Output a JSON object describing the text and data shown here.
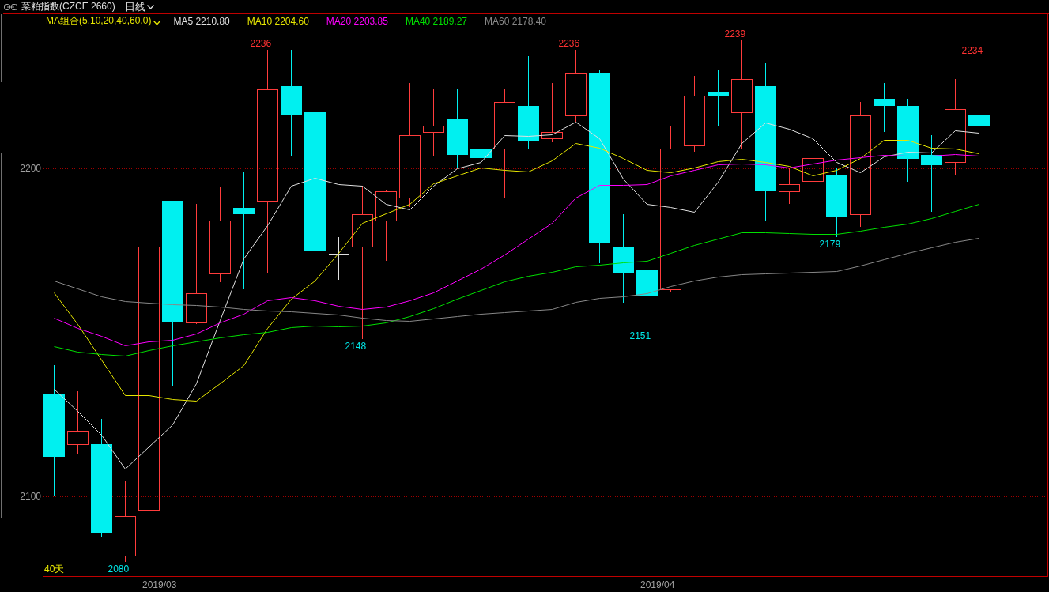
{
  "header": {
    "symbol": "菜粕指数(CZCE 2660)",
    "period": "日线"
  },
  "legend": {
    "indicator": "MA组合(5,10,20,40,60,0)",
    "items": [
      {
        "label": "MA5 2210.80",
        "color": "#e0e0e0"
      },
      {
        "label": "MA10 2204.60",
        "color": "#e6e600"
      },
      {
        "label": "MA20 2203.85",
        "color": "#ff00ff"
      },
      {
        "label": "MA40 2189.27",
        "color": "#00e000"
      },
      {
        "label": "MA60 2178.40",
        "color": "#888888"
      }
    ]
  },
  "axes": {
    "y_labels": [
      "2200",
      "2100"
    ],
    "x_labels": [
      "2019/03",
      "2019/04"
    ]
  },
  "chart": {
    "range_label": "40天",
    "price_labels": [
      {
        "text": "2080",
        "kind": "low"
      },
      {
        "text": "2236",
        "kind": "high"
      },
      {
        "text": "2148",
        "kind": "low"
      },
      {
        "text": "2236",
        "kind": "high"
      },
      {
        "text": "2151",
        "kind": "low"
      },
      {
        "text": "2239",
        "kind": "high"
      },
      {
        "text": "2179",
        "kind": "low"
      },
      {
        "text": "2234",
        "kind": "high"
      }
    ]
  }
}
